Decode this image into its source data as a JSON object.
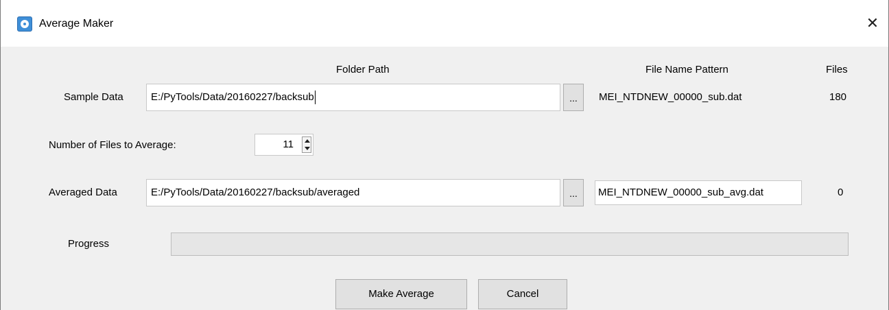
{
  "window": {
    "title": "Average Maker",
    "close_glyph": "✕"
  },
  "headers": {
    "folder_path": "Folder Path",
    "file_name_pattern": "File Name Pattern",
    "files": "Files"
  },
  "sample": {
    "label": "Sample Data",
    "path": "E:/PyTools/Data/20160227/backsub",
    "browse_label": "...",
    "pattern": "MEI_NTDNEW_00000_sub.dat",
    "count": "180"
  },
  "average_count": {
    "label": "Number of Files to Average:",
    "value": "11"
  },
  "averaged": {
    "label": "Averaged Data",
    "path": "E:/PyTools/Data/20160227/backsub/averaged",
    "browse_label": "...",
    "pattern": "MEI_NTDNEW_00000_sub_avg.dat",
    "count": "0"
  },
  "progress": {
    "label": "Progress",
    "value_percent": 0
  },
  "buttons": {
    "make_average": "Make Average",
    "cancel": "Cancel"
  },
  "colors": {
    "window_bg": "#f0f0f0",
    "progress_fill": "#06b025"
  },
  "icons": {
    "app": "app-icon",
    "close": "close-icon"
  }
}
